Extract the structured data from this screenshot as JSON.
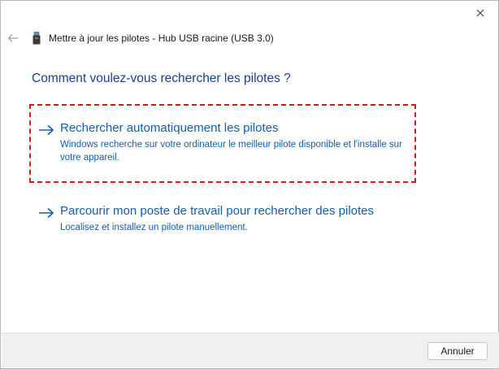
{
  "window": {
    "title": "Mettre à jour les pilotes - Hub USB racine (USB 3.0)"
  },
  "heading": "Comment voulez-vous rechercher les pilotes ?",
  "options": [
    {
      "title": "Rechercher automatiquement les pilotes",
      "description": "Windows recherche sur votre ordinateur le meilleur pilote disponible et l'installe sur votre appareil.",
      "highlighted": true
    },
    {
      "title": "Parcourir mon poste de travail pour rechercher des pilotes",
      "description": "Localisez et installez un pilote manuellement.",
      "highlighted": false
    }
  ],
  "footer": {
    "cancel_label": "Annuler"
  },
  "colors": {
    "link": "#0f5fb5",
    "heading": "#1c3f8f",
    "highlight_border": "#d61a1a",
    "footer_bg": "#f0f0f0"
  },
  "icons": [
    "close-icon",
    "back-arrow-icon",
    "usb-device-icon",
    "arrow-right-icon"
  ]
}
